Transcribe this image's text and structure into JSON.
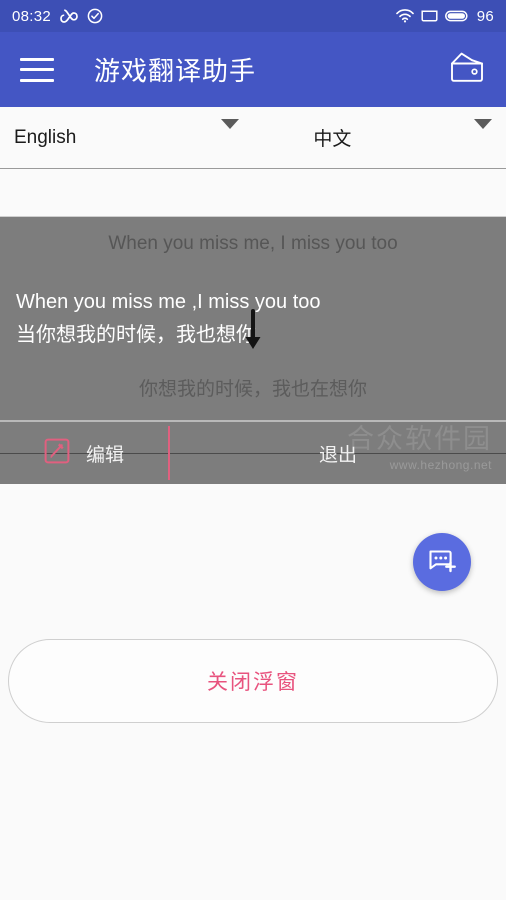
{
  "status_bar": {
    "time": "08:32",
    "battery_percent": "96",
    "icons": [
      "infinity-icon",
      "check-circle-icon",
      "wifi-icon",
      "sim-card-icon",
      "battery-icon"
    ]
  },
  "app_bar": {
    "menu_icon": "hamburger-menu-icon",
    "title": "游戏翻译助手",
    "action_icon": "wallet-icon"
  },
  "language_bar": {
    "source": {
      "value": "English",
      "caret": "chevron-down-icon"
    },
    "target": {
      "value": "中文",
      "caret": "chevron-down-icon"
    }
  },
  "overlay": {
    "previous_line": "When you miss me, I miss you too",
    "current_source": "When you miss me ,I miss you too",
    "current_translation": "当你想我的时候，我也想你",
    "next_line": "你想我的时候，我也在想你",
    "drag_handle_icon": "arrow-down-icon",
    "actions": {
      "edit": {
        "label": "编辑",
        "icon": "edit-pencil-icon"
      },
      "exit": {
        "label": "退出"
      }
    }
  },
  "fab": {
    "icon": "add-message-icon",
    "color": "#5a6ce0"
  },
  "close_button": {
    "label": "关闭浮窗",
    "text_color": "#e8537e"
  },
  "watermark": {
    "name": "合众软件园",
    "url": "www.hezhong.net"
  },
  "theme": {
    "status_bar_bg": "#3d4fb5",
    "app_bar_bg": "#4456c4",
    "overlay_bg": "#7d7d7d",
    "page_bg": "#fafafa",
    "accent_pink": "#e8537e"
  }
}
